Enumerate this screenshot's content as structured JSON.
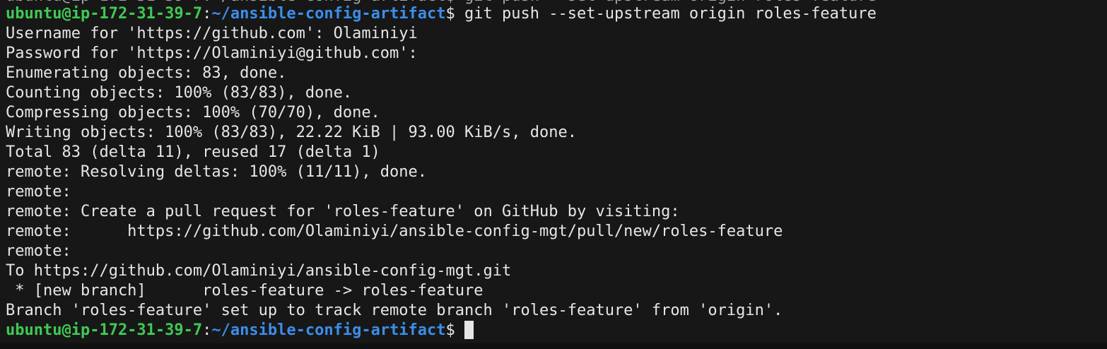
{
  "colors": {
    "background": "#171717",
    "text": "#e6e6e6",
    "prompt_user": "#3fca54",
    "prompt_path": "#3b8eea"
  },
  "terminal": {
    "prompt_top": {
      "user_host": "ubuntu@ip-172-31-39-7",
      "colon": ":",
      "path": "~/ansible-config-artifact",
      "symbol": "$ ",
      "command": "git push --set-upstream origin roles-feature"
    },
    "output": [
      "Username for 'https://github.com': Olaminiyi",
      "Password for 'https://Olaminiyi@github.com':",
      "Enumerating objects: 83, done.",
      "Counting objects: 100% (83/83), done.",
      "Compressing objects: 100% (70/70), done.",
      "Writing objects: 100% (83/83), 22.22 KiB | 93.00 KiB/s, done.",
      "Total 83 (delta 11), reused 17 (delta 1)",
      "remote: Resolving deltas: 100% (11/11), done.",
      "remote:",
      "remote: Create a pull request for 'roles-feature' on GitHub by visiting:",
      "remote:      https://github.com/Olaminiyi/ansible-config-mgt/pull/new/roles-feature",
      "remote:",
      "To https://github.com/Olaminiyi/ansible-config-mgt.git",
      " * [new branch]      roles-feature -> roles-feature",
      "Branch 'roles-feature' set up to track remote branch 'roles-feature' from 'origin'."
    ],
    "prompt_bottom": {
      "user_host": "ubuntu@ip-172-31-39-7",
      "colon": ":",
      "path": "~/ansible-config-artifact",
      "symbol": "$ "
    }
  }
}
